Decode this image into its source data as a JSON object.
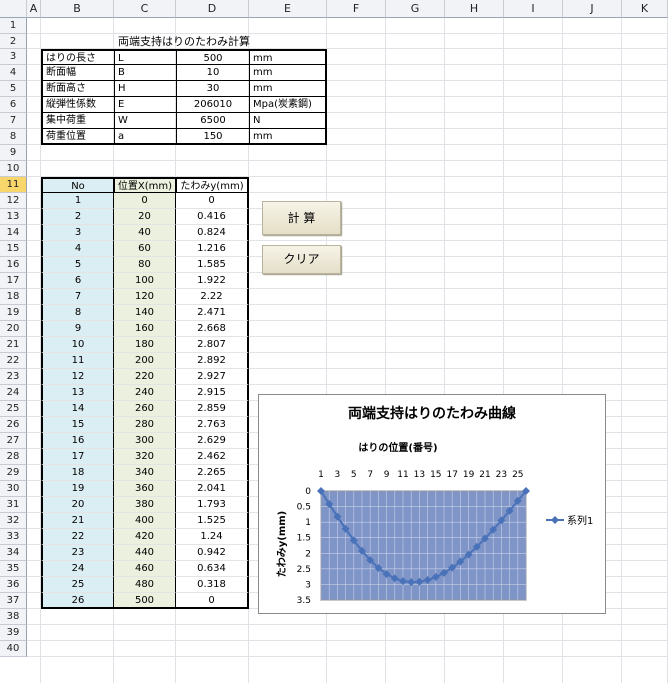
{
  "columns": [
    "A",
    "B",
    "C",
    "D",
    "E",
    "F",
    "G",
    "H",
    "I",
    "J",
    "K"
  ],
  "rows": [
    1,
    2,
    3,
    4,
    5,
    6,
    7,
    8,
    9,
    10,
    11,
    12,
    13,
    14,
    15,
    16,
    17,
    18,
    19,
    20,
    21,
    22,
    23,
    24,
    25,
    26,
    27,
    28,
    29,
    30,
    31,
    32,
    33,
    34,
    35,
    36,
    37,
    38,
    39,
    40
  ],
  "selected_row": 11,
  "sheet_title": "両端支持はりのたわみ計算",
  "params": [
    {
      "name": "はりの長さ",
      "sym": "L",
      "value": "500",
      "unit": "mm"
    },
    {
      "name": "断面幅",
      "sym": "B",
      "value": "10",
      "unit": "mm"
    },
    {
      "name": "断面高さ",
      "sym": "H",
      "value": "30",
      "unit": "mm"
    },
    {
      "name": "縦弾性係数",
      "sym": "E",
      "value": "206010",
      "unit": "Mpa(炭素鋼)"
    },
    {
      "name": "集中荷重",
      "sym": "W",
      "value": "6500",
      "unit": "N"
    },
    {
      "name": "荷重位置",
      "sym": "a",
      "value": "150",
      "unit": "mm"
    }
  ],
  "table": {
    "headers": [
      "No",
      "位置X(mm)",
      "たわみy(mm)"
    ],
    "rows": [
      [
        "1",
        "0",
        "0"
      ],
      [
        "2",
        "20",
        "0.416"
      ],
      [
        "3",
        "40",
        "0.824"
      ],
      [
        "4",
        "60",
        "1.216"
      ],
      [
        "5",
        "80",
        "1.585"
      ],
      [
        "6",
        "100",
        "1.922"
      ],
      [
        "7",
        "120",
        "2.22"
      ],
      [
        "8",
        "140",
        "2.471"
      ],
      [
        "9",
        "160",
        "2.668"
      ],
      [
        "10",
        "180",
        "2.807"
      ],
      [
        "11",
        "200",
        "2.892"
      ],
      [
        "12",
        "220",
        "2.927"
      ],
      [
        "13",
        "240",
        "2.915"
      ],
      [
        "14",
        "260",
        "2.859"
      ],
      [
        "15",
        "280",
        "2.763"
      ],
      [
        "16",
        "300",
        "2.629"
      ],
      [
        "17",
        "320",
        "2.462"
      ],
      [
        "18",
        "340",
        "2.265"
      ],
      [
        "19",
        "360",
        "2.041"
      ],
      [
        "20",
        "380",
        "1.793"
      ],
      [
        "21",
        "400",
        "1.525"
      ],
      [
        "22",
        "420",
        "1.24"
      ],
      [
        "23",
        "440",
        "0.942"
      ],
      [
        "24",
        "460",
        "0.634"
      ],
      [
        "25",
        "480",
        "0.318"
      ],
      [
        "26",
        "500",
        "0"
      ]
    ]
  },
  "buttons": {
    "calc": "計 算",
    "clear": "クリア"
  },
  "colors": {
    "no_col": "#dbeef3",
    "x_col": "#ebf1de",
    "header_sel": "#f8d66c",
    "plot_fill": "#7f95c8",
    "series": "#4a72b8"
  },
  "chart_data": {
    "type": "line",
    "title": "両端支持はりのたわみ曲線",
    "xlabel": "はりの位置(番号)",
    "ylabel": "たわみy(mm)",
    "x_tick_labels": [
      "1",
      "3",
      "5",
      "7",
      "9",
      "11",
      "13",
      "15",
      "17",
      "19",
      "21",
      "23",
      "25"
    ],
    "y_tick_labels": [
      "0",
      "0.5",
      "1",
      "1.5",
      "2",
      "2.5",
      "3",
      "3.5"
    ],
    "ylim": [
      0,
      3.5
    ],
    "y_reversed": true,
    "x_axis_position": "top",
    "legend_position": "right",
    "categories": [
      1,
      2,
      3,
      4,
      5,
      6,
      7,
      8,
      9,
      10,
      11,
      12,
      13,
      14,
      15,
      16,
      17,
      18,
      19,
      20,
      21,
      22,
      23,
      24,
      25,
      26
    ],
    "series": [
      {
        "name": "系列1",
        "values": [
          0,
          0.416,
          0.824,
          1.216,
          1.585,
          1.922,
          2.22,
          2.471,
          2.668,
          2.807,
          2.892,
          2.927,
          2.915,
          2.859,
          2.763,
          2.629,
          2.462,
          2.265,
          2.041,
          1.793,
          1.525,
          1.24,
          0.942,
          0.634,
          0.318,
          0
        ]
      }
    ]
  }
}
